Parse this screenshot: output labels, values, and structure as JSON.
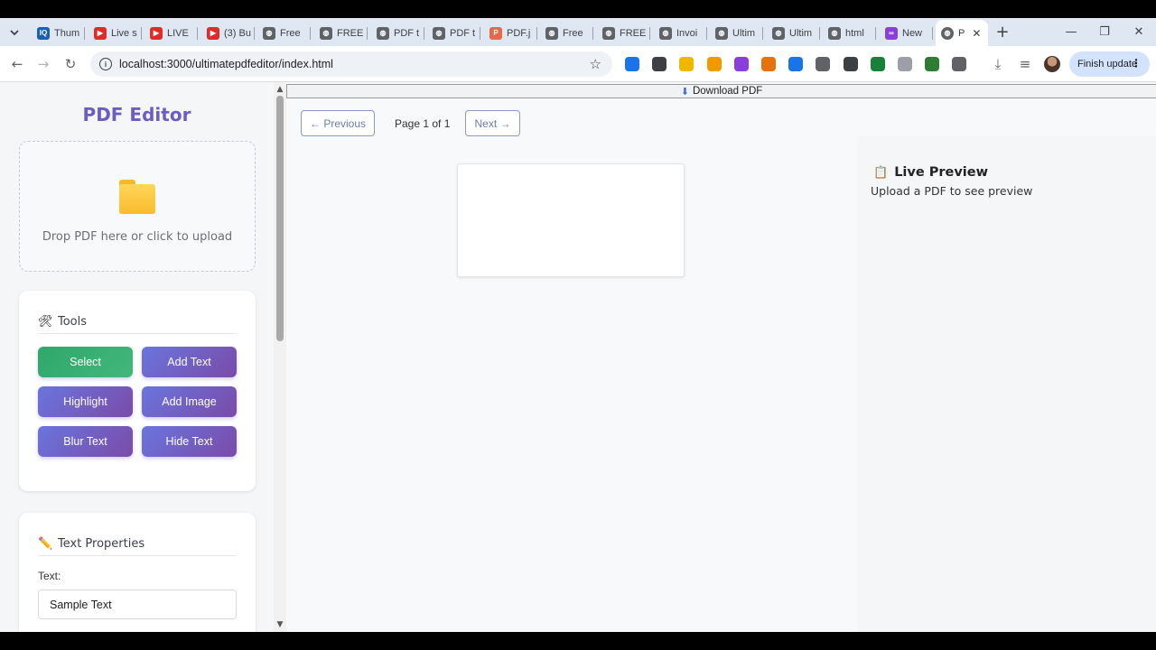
{
  "browser": {
    "tabs": [
      {
        "title": "Thum",
        "icon": "iq-icon",
        "color": "#1a5fb4",
        "glyph": "IQ"
      },
      {
        "title": "Live s",
        "icon": "youtube-icon",
        "color": "#e02b2b",
        "glyph": "▶"
      },
      {
        "title": "LIVE",
        "icon": "youtube-icon",
        "color": "#e02b2b",
        "glyph": "▶"
      },
      {
        "title": "(3) Bu",
        "icon": "youtube-icon",
        "color": "#e02b2b",
        "glyph": "▶"
      },
      {
        "title": "Free",
        "icon": "globe-icon",
        "color": "#5f6368",
        "glyph": "◍"
      },
      {
        "title": "FREE",
        "icon": "globe-icon",
        "color": "#5f6368",
        "glyph": "◍"
      },
      {
        "title": "PDF t",
        "icon": "globe-icon",
        "color": "#5f6368",
        "glyph": "◍"
      },
      {
        "title": "PDF t",
        "icon": "globe-icon",
        "color": "#5f6368",
        "glyph": "◍"
      },
      {
        "title": "PDF.j",
        "icon": "pdf-icon",
        "color": "#e8664a",
        "glyph": "P"
      },
      {
        "title": "Free",
        "icon": "globe-icon",
        "color": "#5f6368",
        "glyph": "◍"
      },
      {
        "title": "FREE",
        "icon": "globe-icon",
        "color": "#5f6368",
        "glyph": "◍"
      },
      {
        "title": "Invoi",
        "icon": "globe-icon",
        "color": "#5f6368",
        "glyph": "◍"
      },
      {
        "title": "Ultim",
        "icon": "globe-icon",
        "color": "#5f6368",
        "glyph": "◍"
      },
      {
        "title": "Ultim",
        "icon": "globe-icon",
        "color": "#5f6368",
        "glyph": "◍"
      },
      {
        "title": "html",
        "icon": "globe-icon",
        "color": "#5f6368",
        "glyph": "◍"
      },
      {
        "title": "New",
        "icon": "copilot-icon",
        "color": "#8b3fd9",
        "glyph": "∞"
      }
    ],
    "active_tab": {
      "title": "P",
      "icon": "globe-icon"
    },
    "url": "localhost:3000/ultimatepdfeditor/index.html",
    "finish_update_label": "Finish update",
    "extensions": [
      {
        "name": "ext-grid-icon",
        "color": "#1a73e8"
      },
      {
        "name": "ext-json-icon",
        "color": "#3c4043"
      },
      {
        "name": "ext-diamond-icon",
        "color": "#f2b600"
      },
      {
        "name": "ext-note-icon",
        "color": "#f29900"
      },
      {
        "name": "ext-purple-icon",
        "color": "#8b3fd9"
      },
      {
        "name": "ext-ring-icon",
        "color": "#e8710a"
      },
      {
        "name": "ext-dot-icon",
        "color": "#1a73e8"
      },
      {
        "name": "ext-shield-icon",
        "color": "#5f6368"
      },
      {
        "name": "ext-download-box-icon",
        "color": "#3c4043"
      },
      {
        "name": "ext-green-arrow-icon",
        "color": "#188038"
      },
      {
        "name": "ext-house-icon",
        "color": "#9aa0a6"
      },
      {
        "name": "ext-globe-icon",
        "color": "#2e7d32"
      },
      {
        "name": "extensions-puzzle-icon",
        "color": "#5f6368"
      }
    ]
  },
  "sidebar": {
    "app_title": "PDF Editor",
    "dropzone_text": "Drop PDF here or click to upload",
    "tools_card": {
      "icon": "tools-icon",
      "title": "Tools",
      "buttons": [
        {
          "label": "Select",
          "active": true
        },
        {
          "label": "Add Text",
          "active": false
        },
        {
          "label": "Highlight",
          "active": false
        },
        {
          "label": "Add Image",
          "active": false
        },
        {
          "label": "Blur Text",
          "active": false
        },
        {
          "label": "Hide Text",
          "active": false
        }
      ]
    },
    "text_props_card": {
      "icon": "pencil-icon",
      "title": "Text Properties",
      "text_label": "Text:",
      "text_value": "Sample Text"
    }
  },
  "main": {
    "download_label": "Download PDF",
    "prev_label": "← Previous",
    "page_info": "Page 1 of 1",
    "next_label": "Next →",
    "preview_title": "Live Preview",
    "preview_subtitle": "Upload a PDF to see preview"
  },
  "colors": {
    "accent_purple": "#6a5fc1",
    "tool_gradient_start": "#6a75de",
    "tool_gradient_end": "#7a4ba8",
    "active_tool_green": "#2fa86a"
  }
}
